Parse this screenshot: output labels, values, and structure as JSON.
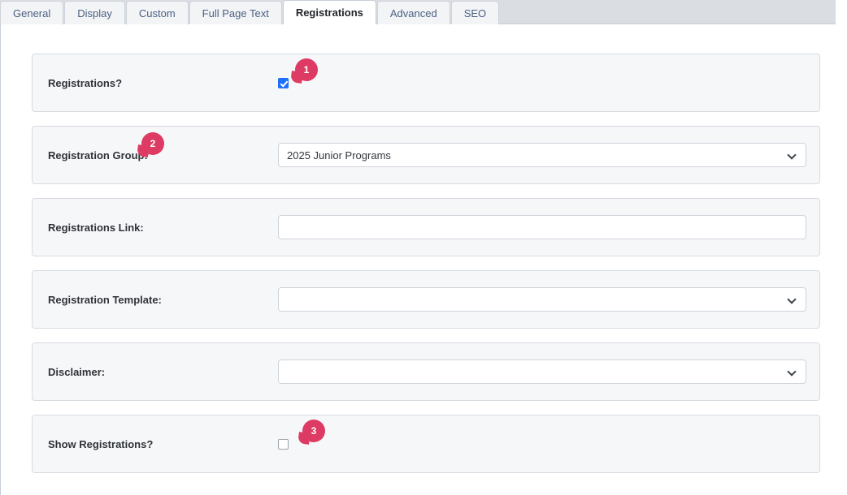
{
  "tabs": [
    {
      "label": "General",
      "active": false
    },
    {
      "label": "Display",
      "active": false
    },
    {
      "label": "Custom",
      "active": false
    },
    {
      "label": "Full Page Text",
      "active": false
    },
    {
      "label": "Registrations",
      "active": true
    },
    {
      "label": "Advanced",
      "active": false
    },
    {
      "label": "SEO",
      "active": false
    }
  ],
  "rows": [
    {
      "label": "Registrations?",
      "control": "checkbox",
      "checked": true,
      "value": "",
      "badge": "1"
    },
    {
      "label": "Registration Group:",
      "control": "select",
      "checked": false,
      "value": "2025 Junior Programs",
      "badge": "2"
    },
    {
      "label": "Registrations Link:",
      "control": "text",
      "checked": false,
      "value": "",
      "placeholder": "",
      "badge": ""
    },
    {
      "label": "Registration Template:",
      "control": "select",
      "checked": false,
      "value": "",
      "badge": ""
    },
    {
      "label": "Disclaimer:",
      "control": "select",
      "checked": false,
      "value": "",
      "badge": ""
    },
    {
      "label": "Show Registrations?",
      "control": "checkbox",
      "checked": false,
      "value": "",
      "badge": "3"
    }
  ],
  "colors": {
    "badge": "#dd3b63",
    "checkbox_checked": "#1e6ffa",
    "tabstrip_bg": "#dadee3",
    "panel_bg": "#f6f7f9",
    "tab_text": "#4d6083"
  }
}
